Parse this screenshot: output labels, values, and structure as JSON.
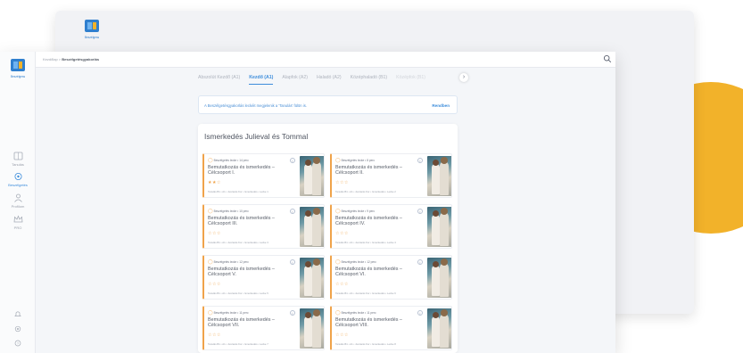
{
  "colors": {
    "accent": "#3d8ddb",
    "card_accent": "#f0a34a",
    "deco_circle": "#f2b22a"
  },
  "app": {
    "logo_text": "Beszélgess"
  },
  "topbar": {
    "breadcrumb_root": "Kezdőlap",
    "breadcrumb_sep": " > ",
    "breadcrumb_current": "Beszélgetésgyakorlás",
    "search_icon": "search-icon"
  },
  "sidebar": {
    "items": [
      {
        "label": "Tanulás",
        "icon": "book-icon"
      },
      {
        "label": "Beszélgetés",
        "icon": "chat-icon"
      },
      {
        "label": "Profilom",
        "icon": "user-icon"
      },
      {
        "label": "PRO",
        "icon": "crown-icon"
      }
    ],
    "bottom_icons": [
      "bell-icon",
      "settings-icon",
      "help-icon"
    ]
  },
  "tabs": [
    {
      "label": "Abszolút Kezdő (A1)",
      "active": false
    },
    {
      "label": "Kezdő (A1)",
      "active": true
    },
    {
      "label": "Alapfok (A2)",
      "active": false
    },
    {
      "label": "Haladó (A2)",
      "active": false
    },
    {
      "label": "Középhaladó (B1)",
      "active": false
    },
    {
      "label": "Középfok (B1)",
      "active": false
    }
  ],
  "info": {
    "text": "A Beszélgetésgyakorlás leckéit megjelenik a 'Tanulás' fülön is.",
    "link": "Rendben"
  },
  "section": {
    "title": "Ismerkedés Julieval és Tommal"
  },
  "cards": [
    {
      "tag": "Beszélgetés lecke • 14 perc",
      "title": "Bemutatkozás és ismerkedés – Célcsoport I.",
      "stars": "★★☆",
      "footer": "Tanulás B1 • A1 • Juszarás Kor • Ismerkedés • Lecke 1"
    },
    {
      "tag": "Beszélgetés lecke • 8 perc",
      "title": "Bemutatkozás és ismerkedés – Célcsoport II.",
      "stars": "☆☆☆",
      "footer": "Tanulás B1 • A1 • Juszarás Kor • Ismerkedés • Lecke 2"
    },
    {
      "tag": "Beszélgetés lecke • 10 perc",
      "title": "Bemutatkozás és ismerkedés – Célcsoport III.",
      "stars": "☆☆☆",
      "footer": "Tanulás B1 • A1 • Juszarás Kor • Ismerkedés • Lecke 3"
    },
    {
      "tag": "Beszélgetés lecke • 9 perc",
      "title": "Bemutatkozás és ismerkedés – Célcsoport IV.",
      "stars": "☆☆☆",
      "footer": "Tanulás B1 • A1 • Juszarás Kor • Ismerkedés • Lecke 4"
    },
    {
      "tag": "Beszélgetés lecke • 12 perc",
      "title": "Bemutatkozás és ismerkedés – Célcsoport V.",
      "stars": "☆☆☆",
      "footer": "Tanulás B1 • A1 • Juszarás Kor • Ismerkedés • Lecke 5"
    },
    {
      "tag": "Beszélgetés lecke • 12 perc",
      "title": "Bemutatkozás és ismerkedés – Célcsoport VI.",
      "stars": "☆☆☆",
      "footer": "Tanulás B1 • A1 • Juszarás Kor • Ismerkedés • Lecke 6"
    },
    {
      "tag": "Beszélgetés lecke • 11 perc",
      "title": "Bemutatkozás és ismerkedés – Célcsoport VII.",
      "stars": "☆☆☆",
      "footer": "Tanulás B1 • A1 • Juszarás Kor • Ismerkedés • Lecke 7"
    },
    {
      "tag": "Beszélgetés lecke • 11 perc",
      "title": "Bemutatkozás és ismerkedés – Célcsoport VIII.",
      "stars": "☆☆☆",
      "footer": "Tanulás B1 • A1 • Juszarás Kor • Ismerkedés • Lecke 8"
    }
  ]
}
